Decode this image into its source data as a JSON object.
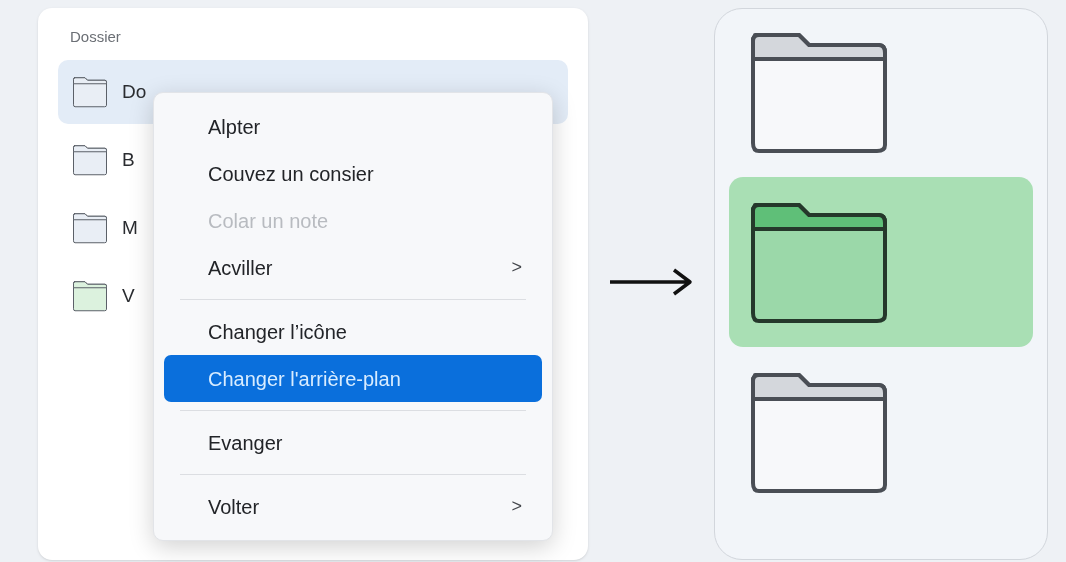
{
  "panel": {
    "title": "Dossier",
    "items": [
      {
        "label": "Do",
        "selected": true,
        "color": "#e9eef5"
      },
      {
        "label": "B",
        "selected": false,
        "color": "#e9eef5"
      },
      {
        "label": "M",
        "selected": false,
        "color": "#e9eef5"
      },
      {
        "label": "V",
        "selected": false,
        "color": "#dcf2de"
      }
    ]
  },
  "context_menu": {
    "items": [
      {
        "kind": "item",
        "label": "Alpter",
        "disabled": false,
        "selected": false
      },
      {
        "kind": "item",
        "label": "Couvez un consier",
        "disabled": false,
        "selected": false
      },
      {
        "kind": "item",
        "label": "Colar un note",
        "disabled": true,
        "selected": false
      },
      {
        "kind": "item",
        "label": "Acviller",
        "disabled": false,
        "selected": false,
        "chevron": ">"
      },
      {
        "kind": "separator"
      },
      {
        "kind": "item",
        "label": "Changer l’icône",
        "disabled": false,
        "selected": false
      },
      {
        "kind": "item",
        "label": "Changer l'arrière-plan",
        "disabled": false,
        "selected": true
      },
      {
        "kind": "separator"
      },
      {
        "kind": "item",
        "label": "Evanger",
        "disabled": false,
        "selected": false
      },
      {
        "kind": "separator"
      },
      {
        "kind": "item",
        "label": "Volter",
        "disabled": false,
        "selected": false,
        "chevron": ">"
      }
    ]
  },
  "preview": {
    "folders": [
      {
        "selected": false
      },
      {
        "selected": true
      },
      {
        "selected": false
      }
    ]
  }
}
